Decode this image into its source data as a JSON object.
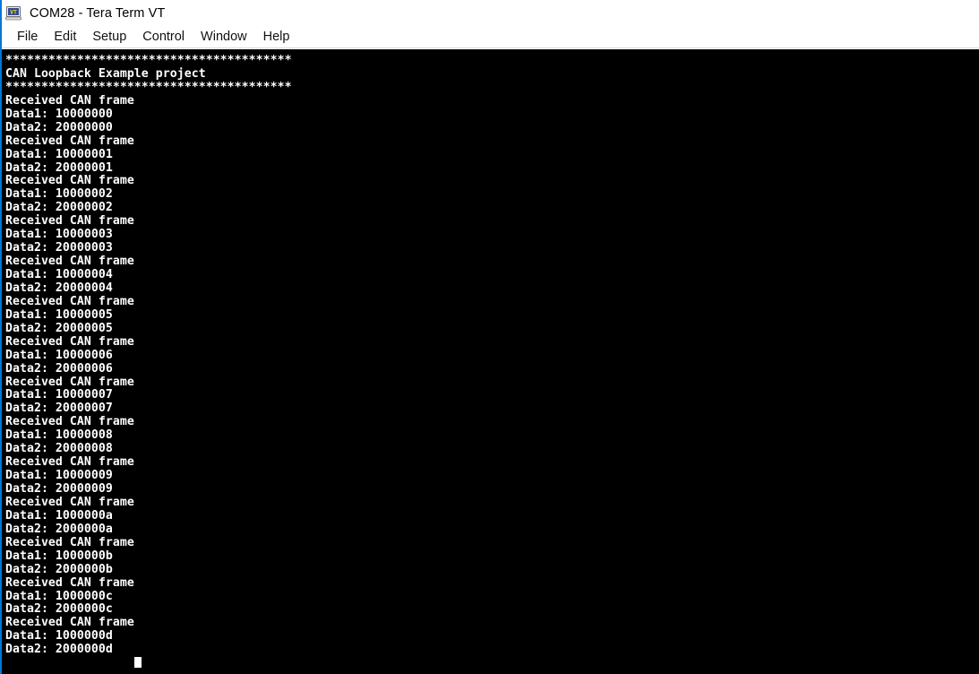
{
  "window": {
    "title": "COM28 - Tera Term VT",
    "icon": "terminal-vt-icon",
    "icon_label": "VT",
    "accent_color": "#0078d7",
    "titlebar_bg": "#ffffff"
  },
  "menubar": {
    "items": [
      {
        "label": "File"
      },
      {
        "label": "Edit"
      },
      {
        "label": "Setup"
      },
      {
        "label": "Control"
      },
      {
        "label": "Window"
      },
      {
        "label": "Help"
      }
    ]
  },
  "terminal": {
    "background_color": "#000000",
    "foreground_color": "#ffffff",
    "banner_rule": "****************************************",
    "banner_title": "CAN Loopback Example project",
    "frame_label": "Received CAN frame",
    "data1_prefix": "Data1: ",
    "data2_prefix": "Data2: ",
    "lines": [
      "****************************************",
      "CAN Loopback Example project",
      "****************************************",
      "Received CAN frame",
      "Data1: 10000000",
      "Data2: 20000000",
      "Received CAN frame",
      "Data1: 10000001",
      "Data2: 20000001",
      "Received CAN frame",
      "Data1: 10000002",
      "Data2: 20000002",
      "Received CAN frame",
      "Data1: 10000003",
      "Data2: 20000003",
      "Received CAN frame",
      "Data1: 10000004",
      "Data2: 20000004",
      "Received CAN frame",
      "Data1: 10000005",
      "Data2: 20000005",
      "Received CAN frame",
      "Data1: 10000006",
      "Data2: 20000006",
      "Received CAN frame",
      "Data1: 10000007",
      "Data2: 20000007",
      "Received CAN frame",
      "Data1: 10000008",
      "Data2: 20000008",
      "Received CAN frame",
      "Data1: 10000009",
      "Data2: 20000009",
      "Received CAN frame",
      "Data1: 1000000a",
      "Data2: 2000000a",
      "Received CAN frame",
      "Data1: 1000000b",
      "Data2: 2000000b",
      "Received CAN frame",
      "Data1: 1000000c",
      "Data2: 2000000c",
      "Received CAN frame",
      "Data1: 1000000d",
      "Data2: 2000000d"
    ],
    "cursor": {
      "visible": true,
      "column": 18,
      "shape": "block"
    }
  }
}
